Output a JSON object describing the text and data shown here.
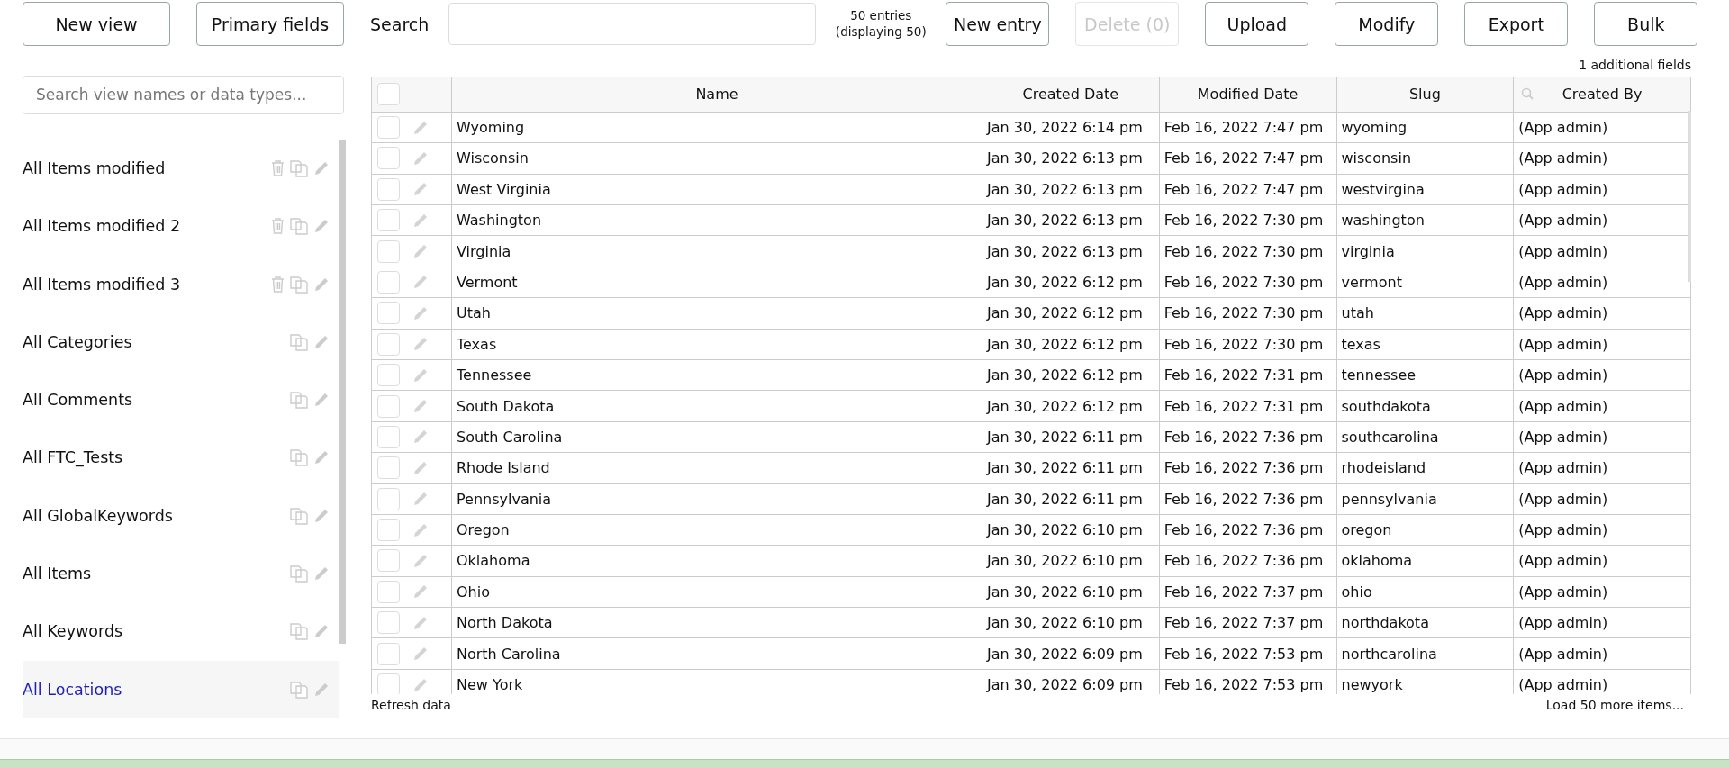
{
  "toolbar": {
    "buttons_left": [
      {
        "label": "New view",
        "disabled": false
      },
      {
        "label": "Primary fields",
        "disabled": false
      }
    ],
    "search": {
      "label": "Search"
    },
    "entries_count": "50 entries",
    "entries_displayed": "(displaying 50)",
    "buttons_right": [
      {
        "label": "New entry",
        "disabled": false
      },
      {
        "label": "Delete (0)",
        "disabled": true
      },
      {
        "label": "Upload",
        "disabled": false
      },
      {
        "label": "Modify",
        "disabled": false
      },
      {
        "label": "Export",
        "disabled": false
      },
      {
        "label": "Bulk",
        "disabled": false
      }
    ]
  },
  "sidebar": {
    "search": {
      "placeholder": "Search view names or data types..."
    },
    "items": [
      {
        "label": "All Items modified",
        "deletable": true,
        "selected": false
      },
      {
        "label": "All Items modified 2",
        "deletable": true,
        "selected": false
      },
      {
        "label": "All Items modified 3",
        "deletable": true,
        "selected": false
      },
      {
        "label": "All Categories",
        "deletable": false,
        "selected": false
      },
      {
        "label": "All Comments",
        "deletable": false,
        "selected": false
      },
      {
        "label": "All FTC_Tests",
        "deletable": false,
        "selected": false
      },
      {
        "label": "All GlobalKeywords",
        "deletable": false,
        "selected": false
      },
      {
        "label": "All Items",
        "deletable": false,
        "selected": false
      },
      {
        "label": "All Keywords",
        "deletable": false,
        "selected": false
      },
      {
        "label": "All Locations",
        "deletable": false,
        "selected": true
      }
    ]
  },
  "table": {
    "additional_fields": "1 additional fields",
    "header_checked": false,
    "columns": [
      {
        "label": "Name",
        "search_icon": false
      },
      {
        "label": "Created Date",
        "search_icon": false
      },
      {
        "label": "Modified Date",
        "search_icon": false
      },
      {
        "label": "Slug",
        "search_icon": false
      },
      {
        "label": "Created By",
        "search_icon": true
      }
    ],
    "rows": [
      {
        "checked": false,
        "cells": [
          "Wyoming",
          "Jan 30, 2022 6:14 pm",
          "Feb 16, 2022 7:47 pm",
          "wyoming",
          "(App admin)"
        ]
      },
      {
        "checked": false,
        "cells": [
          "Wisconsin",
          "Jan 30, 2022 6:13 pm",
          "Feb 16, 2022 7:47 pm",
          "wisconsin",
          "(App admin)"
        ]
      },
      {
        "checked": false,
        "cells": [
          "West Virginia",
          "Jan 30, 2022 6:13 pm",
          "Feb 16, 2022 7:47 pm",
          "westvirgina",
          "(App admin)"
        ]
      },
      {
        "checked": false,
        "cells": [
          "Washington",
          "Jan 30, 2022 6:13 pm",
          "Feb 16, 2022 7:30 pm",
          "washington",
          "(App admin)"
        ]
      },
      {
        "checked": false,
        "cells": [
          "Virginia",
          "Jan 30, 2022 6:13 pm",
          "Feb 16, 2022 7:30 pm",
          "virginia",
          "(App admin)"
        ]
      },
      {
        "checked": false,
        "cells": [
          "Vermont",
          "Jan 30, 2022 6:12 pm",
          "Feb 16, 2022 7:30 pm",
          "vermont",
          "(App admin)"
        ]
      },
      {
        "checked": false,
        "cells": [
          "Utah",
          "Jan 30, 2022 6:12 pm",
          "Feb 16, 2022 7:30 pm",
          "utah",
          "(App admin)"
        ]
      },
      {
        "checked": false,
        "cells": [
          "Texas",
          "Jan 30, 2022 6:12 pm",
          "Feb 16, 2022 7:30 pm",
          "texas",
          "(App admin)"
        ]
      },
      {
        "checked": false,
        "cells": [
          "Tennessee",
          "Jan 30, 2022 6:12 pm",
          "Feb 16, 2022 7:31 pm",
          "tennessee",
          "(App admin)"
        ]
      },
      {
        "checked": false,
        "cells": [
          "South Dakota",
          "Jan 30, 2022 6:12 pm",
          "Feb 16, 2022 7:31 pm",
          "southdakota",
          "(App admin)"
        ]
      },
      {
        "checked": false,
        "cells": [
          "South Carolina",
          "Jan 30, 2022 6:11 pm",
          "Feb 16, 2022 7:36 pm",
          "southcarolina",
          "(App admin)"
        ]
      },
      {
        "checked": false,
        "cells": [
          "Rhode Island",
          "Jan 30, 2022 6:11 pm",
          "Feb 16, 2022 7:36 pm",
          "rhodeisland",
          "(App admin)"
        ]
      },
      {
        "checked": false,
        "cells": [
          "Pennsylvania",
          "Jan 30, 2022 6:11 pm",
          "Feb 16, 2022 7:36 pm",
          "pennsylvania",
          "(App admin)"
        ]
      },
      {
        "checked": false,
        "cells": [
          "Oregon",
          "Jan 30, 2022 6:10 pm",
          "Feb 16, 2022 7:36 pm",
          "oregon",
          "(App admin)"
        ]
      },
      {
        "checked": false,
        "cells": [
          "Oklahoma",
          "Jan 30, 2022 6:10 pm",
          "Feb 16, 2022 7:36 pm",
          "oklahoma",
          "(App admin)"
        ]
      },
      {
        "checked": false,
        "cells": [
          "Ohio",
          "Jan 30, 2022 6:10 pm",
          "Feb 16, 2022 7:37 pm",
          "ohio",
          "(App admin)"
        ]
      },
      {
        "checked": false,
        "cells": [
          "North Dakota",
          "Jan 30, 2022 6:10 pm",
          "Feb 16, 2022 7:37 pm",
          "northdakota",
          "(App admin)"
        ]
      },
      {
        "checked": false,
        "cells": [
          "North Carolina",
          "Jan 30, 2022 6:09 pm",
          "Feb 16, 2022 7:53 pm",
          "northcarolina",
          "(App admin)"
        ]
      },
      {
        "checked": false,
        "cells": [
          "New York",
          "Jan 30, 2022 6:09 pm",
          "Feb 16, 2022 7:53 pm",
          "newyork",
          "(App admin)"
        ]
      }
    ],
    "refresh_link": "Refresh data",
    "load_more_link": "Load 50 more items..."
  }
}
